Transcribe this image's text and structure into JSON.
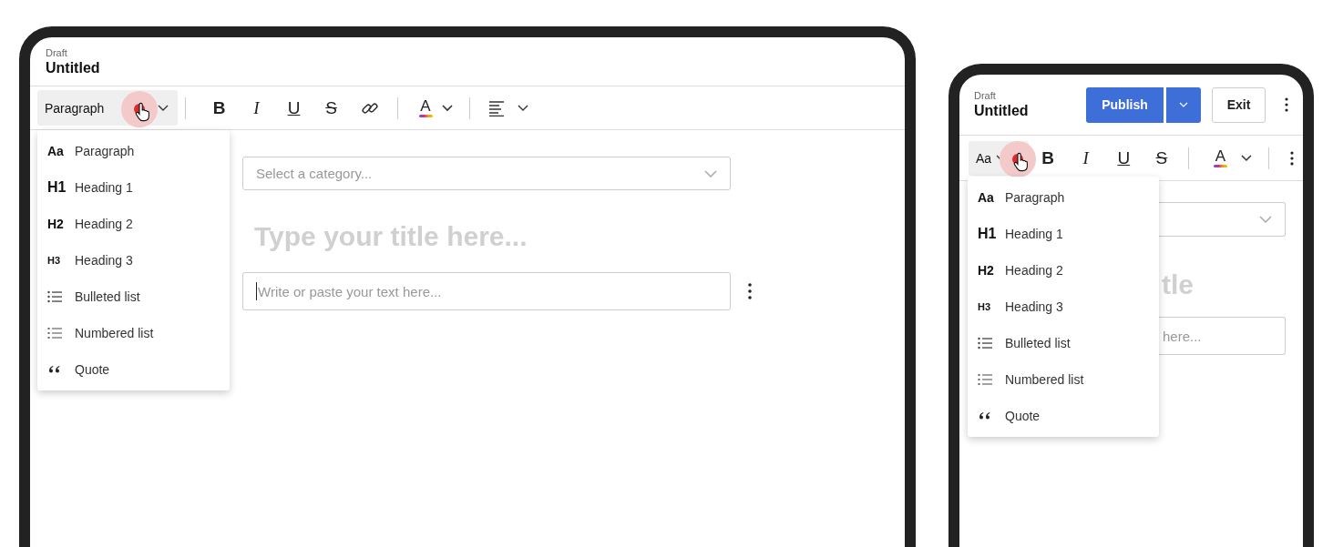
{
  "tablet": {
    "header": {
      "status": "Draft",
      "title": "Untitled"
    },
    "block_style": "Paragraph",
    "tools": [
      {
        "kind": "bold",
        "glyph": "B"
      },
      {
        "kind": "italic",
        "glyph": "I"
      },
      {
        "kind": "underline",
        "glyph": "U"
      },
      {
        "kind": "strike",
        "glyph": "S"
      },
      {
        "kind": "link"
      },
      {
        "kind": "separator"
      },
      {
        "kind": "color",
        "glyph": "A"
      },
      {
        "kind": "separator"
      },
      {
        "kind": "align"
      }
    ],
    "menu": [
      {
        "kind": "paragraph",
        "glyph": "Aa",
        "text": "Paragraph"
      },
      {
        "kind": "heading1",
        "glyph": "H1",
        "text": "Heading 1"
      },
      {
        "kind": "heading2",
        "glyph": "H2",
        "text": "Heading 2"
      },
      {
        "kind": "heading3",
        "glyph": "H3",
        "text": "Heading 3"
      },
      {
        "kind": "bullets",
        "text": "Bulleted list"
      },
      {
        "kind": "numbers",
        "text": "Numbered list"
      },
      {
        "kind": "quote",
        "text": "Quote"
      }
    ],
    "category": {
      "placeholder": "Select a category..."
    },
    "title": {
      "placeholder": "Type your title here..."
    },
    "body": {
      "placeholder": "Write or paste your text here..."
    }
  },
  "phone": {
    "header": {
      "status": "Draft",
      "title": "Untitled"
    },
    "buttons": [
      {
        "kind": "primary",
        "label": "Publish"
      },
      {
        "kind": "split"
      },
      {
        "kind": "outline",
        "label": "Exit"
      }
    ],
    "block_style": "Aa",
    "tools": [
      {
        "kind": "bold",
        "glyph": "B"
      },
      {
        "kind": "italic",
        "glyph": "I"
      },
      {
        "kind": "underline",
        "glyph": "U"
      },
      {
        "kind": "strike",
        "glyph": "S"
      },
      {
        "kind": "separator"
      },
      {
        "kind": "color",
        "glyph": "A"
      },
      {
        "kind": "separator"
      },
      {
        "kind": "more"
      }
    ],
    "menu": [
      {
        "kind": "paragraph",
        "glyph": "Aa",
        "text": "Paragraph"
      },
      {
        "kind": "heading1",
        "glyph": "H1",
        "text": "Heading 1"
      },
      {
        "kind": "heading2",
        "glyph": "H2",
        "text": "Heading 2"
      },
      {
        "kind": "heading3",
        "glyph": "H3",
        "text": "Heading 3"
      },
      {
        "kind": "bullets",
        "text": "Bulleted list"
      },
      {
        "kind": "numbers",
        "text": "Numbered list"
      },
      {
        "kind": "quote",
        "text": "Quote"
      }
    ],
    "title_fragment": "tle",
    "body_fragment": "here..."
  }
}
